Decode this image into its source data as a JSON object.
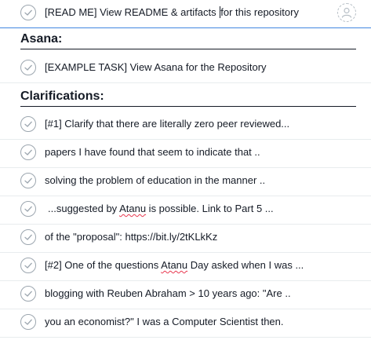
{
  "tasks": {
    "readme": {
      "before_cursor": "[READ ME] View README & artifacts ",
      "after_cursor": "for this repository"
    },
    "asana_task": "[EXAMPLE TASK] View Asana for the Repository",
    "clar_1": "[#1] Clarify that there are literally zero peer reviewed...",
    "clar_2": "papers I have found that seem to indicate that ..",
    "clar_3": "solving the problem of education in the manner ..",
    "clar_4": {
      "before": "...suggested by ",
      "name": "Atanu",
      "after": " is possible. Link to Part 5 ..."
    },
    "clar_5": "of the \"proposal\": https://bit.ly/2tKLkKz",
    "clar_6": {
      "before": "[#2] One of the questions ",
      "name": "Atanu",
      "after": " Day asked when I was ..."
    },
    "clar_7": "blogging with Reuben Abraham > 10 years ago: \"Are ..",
    "clar_8": "you an economist?\" I was a Computer Scientist then."
  },
  "sections": {
    "asana": "Asana:",
    "clarifications": "Clarifications:"
  },
  "icons": {
    "complete": "checkmark-circle-icon",
    "assignee": "unassigned-person-icon"
  }
}
